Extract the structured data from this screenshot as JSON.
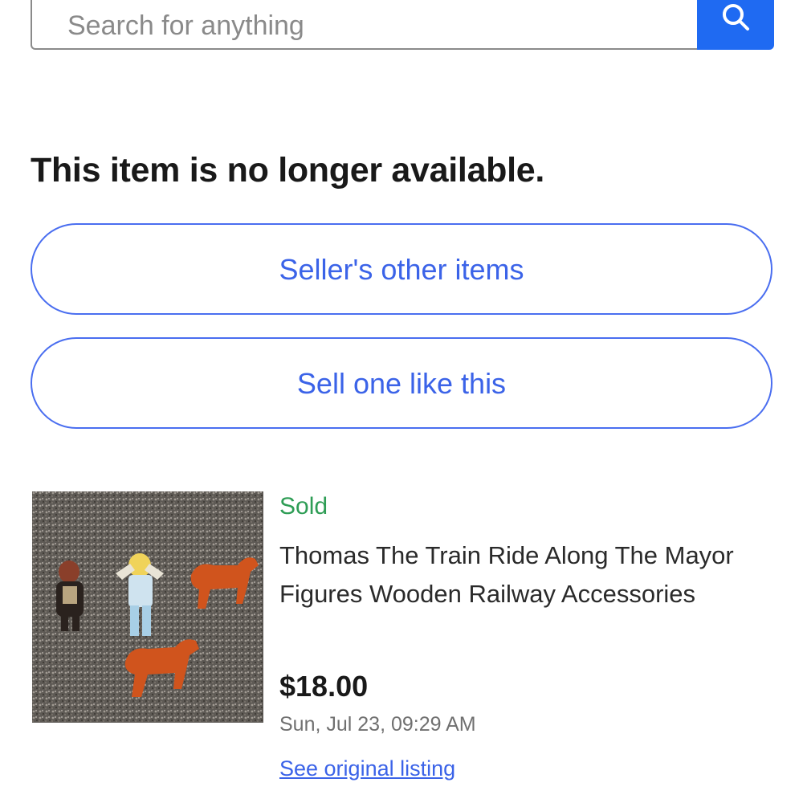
{
  "search": {
    "placeholder": "Search for anything",
    "button_icon": "search-icon",
    "accent_color": "#1f6af2"
  },
  "notice": {
    "heading": "This item is no longer available."
  },
  "actions": {
    "sellers_other_items": "Seller's other items",
    "sell_one_like_this": "Sell one like this"
  },
  "listing": {
    "status": "Sold",
    "status_color": "#2e9d55",
    "title": "Thomas The Train Ride Along The Mayor Figures Wooden Railway Accessories",
    "price": "$18.00",
    "date": "Sun, Jul 23, 09:29 AM",
    "link": "See original listing"
  }
}
